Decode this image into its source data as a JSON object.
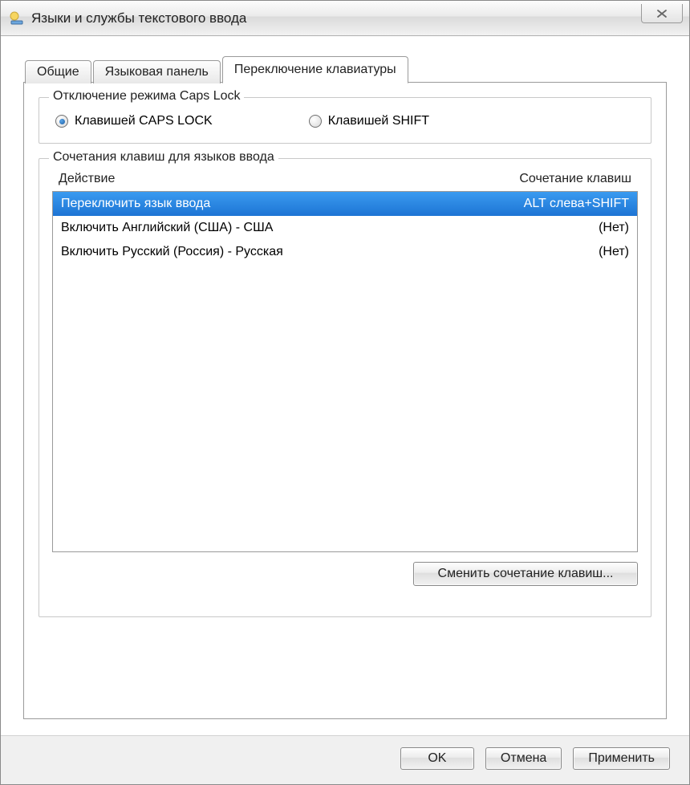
{
  "window": {
    "title": "Языки и службы текстового ввода"
  },
  "tabs": {
    "general": "Общие",
    "language_bar": "Языковая панель",
    "keyboard_switch": "Переключение клавиатуры"
  },
  "capslock_group": {
    "legend": "Отключение режима Caps Lock",
    "option_caps": "Клавишей CAPS LOCK",
    "option_shift": "Клавишей SHIFT"
  },
  "hotkeys_group": {
    "legend": "Сочетания клавиш для языков ввода",
    "col_action": "Действие",
    "col_shortcut": "Сочетание клавиш",
    "rows": [
      {
        "action": "Переключить язык ввода",
        "shortcut": "ALT слева+SHIFT"
      },
      {
        "action": "Включить Английский (США) - США",
        "shortcut": "(Нет)"
      },
      {
        "action": "Включить Русский (Россия) - Русская",
        "shortcut": "(Нет)"
      }
    ],
    "change_button": "Сменить сочетание клавиш..."
  },
  "buttons": {
    "ok": "OK",
    "cancel": "Отмена",
    "apply": "Применить"
  }
}
